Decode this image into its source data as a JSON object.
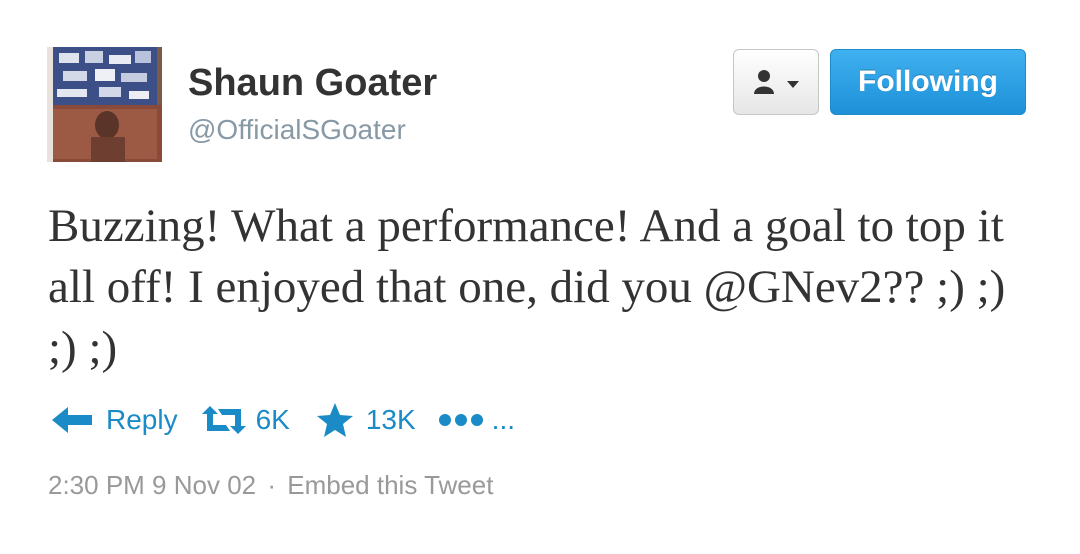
{
  "user": {
    "name": "Shaun Goater",
    "handle": "@OfficialSGoater"
  },
  "buttons": {
    "follow_label": "Following"
  },
  "tweet": {
    "text": "Buzzing! What a performance! And a goal to top it all off! I enjoyed that one, did you @GNev2?? ;) ;) ;) ;)"
  },
  "actions": {
    "reply_label": "Reply",
    "retweet_count": "6K",
    "favorite_count": "13K",
    "more_label": "..."
  },
  "meta": {
    "timestamp": "2:30 PM 9 Nov 02",
    "separator": "·",
    "embed_label": "Embed this Tweet"
  },
  "colors": {
    "link_blue": "#1b8bc7",
    "follow_blue": "#2a9fe3",
    "text_dark": "#333333",
    "text_muted": "#999999"
  },
  "icons": [
    "person-icon",
    "caret-down-icon",
    "reply-icon",
    "retweet-icon",
    "star-icon",
    "more-dots-icon"
  ]
}
